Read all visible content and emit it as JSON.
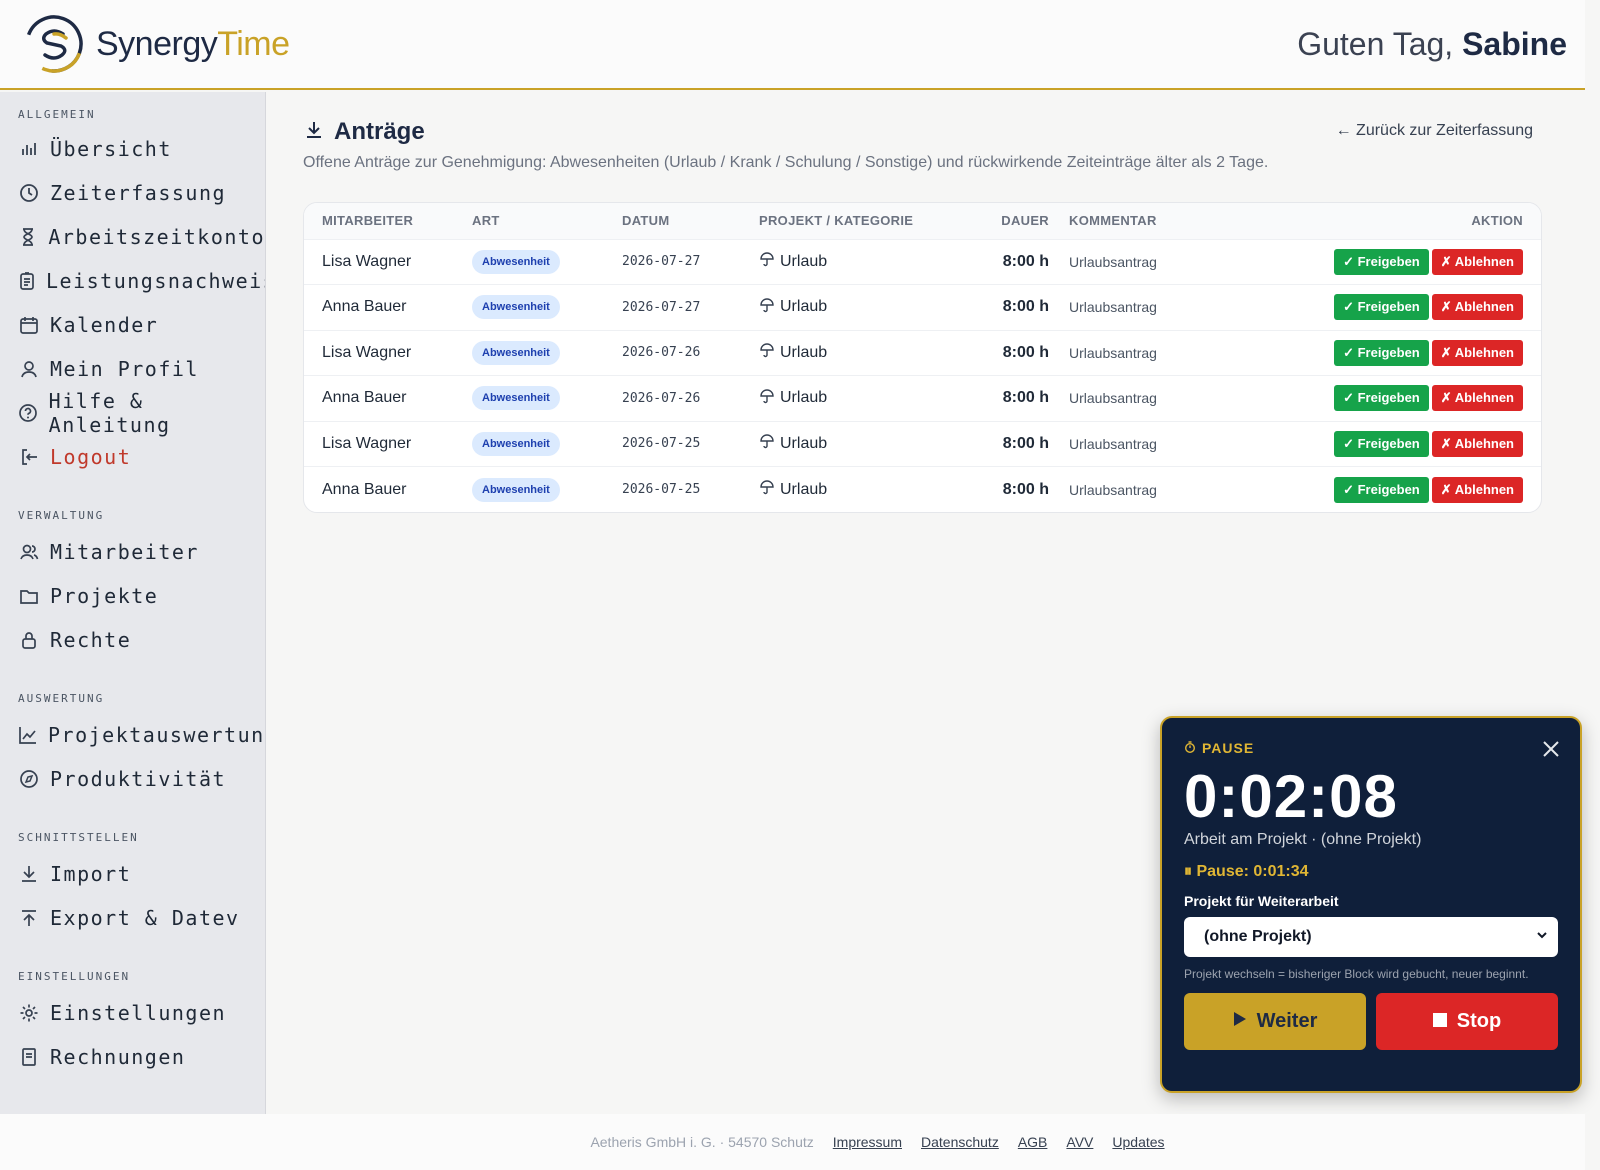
{
  "brand": {
    "name_part1": "Synergy",
    "name_part2": "Time"
  },
  "header": {
    "greeting": "Guten Tag,",
    "user": "Sabine"
  },
  "sidebar": {
    "sections": [
      {
        "title": "ALLGEMEIN",
        "items": [
          {
            "label": "Übersicht",
            "icon": "bar-chart-icon"
          },
          {
            "label": "Zeiterfassung",
            "icon": "clock-icon"
          },
          {
            "label": "Arbeitszeitkonto",
            "icon": "hourglass-icon"
          },
          {
            "label": "Leistungsnachweis",
            "icon": "clipboard-icon"
          },
          {
            "label": "Kalender",
            "icon": "calendar-icon"
          },
          {
            "label": "Mein Profil",
            "icon": "user-icon"
          },
          {
            "label": "Hilfe & Anleitung",
            "icon": "help-icon"
          },
          {
            "label": "Logout",
            "icon": "logout-icon"
          }
        ]
      },
      {
        "title": "VERWALTUNG",
        "items": [
          {
            "label": "Mitarbeiter",
            "icon": "users-icon"
          },
          {
            "label": "Projekte",
            "icon": "folder-icon"
          },
          {
            "label": "Rechte",
            "icon": "lock-icon"
          }
        ]
      },
      {
        "title": "AUSWERTUNG",
        "items": [
          {
            "label": "Projektauswertung",
            "icon": "line-chart-icon"
          },
          {
            "label": "Produktivität",
            "icon": "compass-icon"
          }
        ]
      },
      {
        "title": "SCHNITTSTELLEN",
        "items": [
          {
            "label": "Import",
            "icon": "download-icon"
          },
          {
            "label": "Export & Datev",
            "icon": "upload-icon"
          }
        ]
      },
      {
        "title": "EINSTELLUNGEN",
        "items": [
          {
            "label": "Einstellungen",
            "icon": "gear-icon"
          },
          {
            "label": "Rechnungen",
            "icon": "invoice-icon"
          }
        ]
      }
    ]
  },
  "main": {
    "title": "Anträge",
    "back_link": "← Zurück zur Zeiterfassung",
    "subtitle": "Offene Anträge zur Genehmigung: Abwesenheiten (Urlaub / Krank / Schulung / Sonstige) und rückwirkende Zeiteinträge älter als 2 Tage.",
    "columns": [
      "MITARBEITER",
      "ART",
      "DATUM",
      "PROJEKT / KATEGORIE",
      "DAUER",
      "KOMMENTAR",
      "AKTION"
    ],
    "approve_label": "✓ Freigeben",
    "reject_label": "✗ Ablehnen",
    "rows": [
      {
        "employee": "Lisa Wagner",
        "type": "Abwesenheit",
        "date": "2026-07-27",
        "category": "Urlaub",
        "duration": "8:00 h",
        "comment": "Urlaubsantrag"
      },
      {
        "employee": "Anna Bauer",
        "type": "Abwesenheit",
        "date": "2026-07-27",
        "category": "Urlaub",
        "duration": "8:00 h",
        "comment": "Urlaubsantrag"
      },
      {
        "employee": "Lisa Wagner",
        "type": "Abwesenheit",
        "date": "2026-07-26",
        "category": "Urlaub",
        "duration": "8:00 h",
        "comment": "Urlaubsantrag"
      },
      {
        "employee": "Anna Bauer",
        "type": "Abwesenheit",
        "date": "2026-07-26",
        "category": "Urlaub",
        "duration": "8:00 h",
        "comment": "Urlaubsantrag"
      },
      {
        "employee": "Lisa Wagner",
        "type": "Abwesenheit",
        "date": "2026-07-25",
        "category": "Urlaub",
        "duration": "8:00 h",
        "comment": "Urlaubsantrag"
      },
      {
        "employee": "Anna Bauer",
        "type": "Abwesenheit",
        "date": "2026-07-25",
        "category": "Urlaub",
        "duration": "8:00 h",
        "comment": "Urlaubsantrag"
      }
    ]
  },
  "timer": {
    "state": "PAUSE",
    "time": "0:02:08",
    "description": "Arbeit am Projekt · (ohne Projekt)",
    "pause": "Pause: 0:01:34",
    "project_label": "Projekt für Weiterarbeit",
    "project_selected": "(ohne Projekt)",
    "hint": "Projekt wechseln = bisheriger Block wird gebucht, neuer beginnt.",
    "continue_label": "Weiter",
    "stop_label": "Stop"
  },
  "footer": {
    "company": "Aetheris GmbH i. G. · 54570 Schutz",
    "links": [
      "Impressum",
      "Datenschutz",
      "AGB",
      "AVV",
      "Updates"
    ]
  },
  "colors": {
    "navy": "#1e2a44",
    "gold": "#c9a227",
    "approve": "#16a34a",
    "reject": "#dc2626"
  }
}
